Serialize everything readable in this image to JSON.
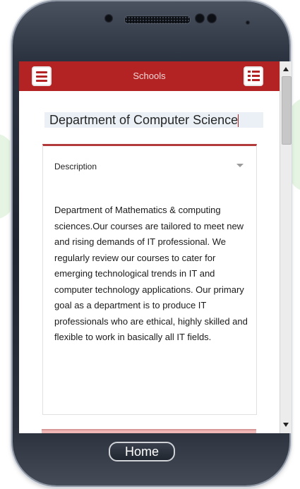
{
  "colors": {
    "header_red": "#b42323",
    "accent_border": "#b23a3a",
    "title_bg": "#eaf0f5",
    "phone_body": "#1f2530"
  },
  "app_bar": {
    "title": "Schools",
    "left_icon": "menu-icon",
    "right_icon": "list-icon"
  },
  "page": {
    "title": "Department of Computer Science"
  },
  "card": {
    "header": "Description",
    "toggle_icon": "chevron-down-icon",
    "body": "Department of Mathematics & computing sciences.Our courses are tailored to meet new and rising demands of IT professional. We regularly review our courses to cater for emerging technological trends in IT and computer technology applications. Our primary goal as a department is to produce IT professionals who are ethical, highly skilled and flexible to work in basically all IT fields."
  },
  "device": {
    "home_label": "Home"
  }
}
